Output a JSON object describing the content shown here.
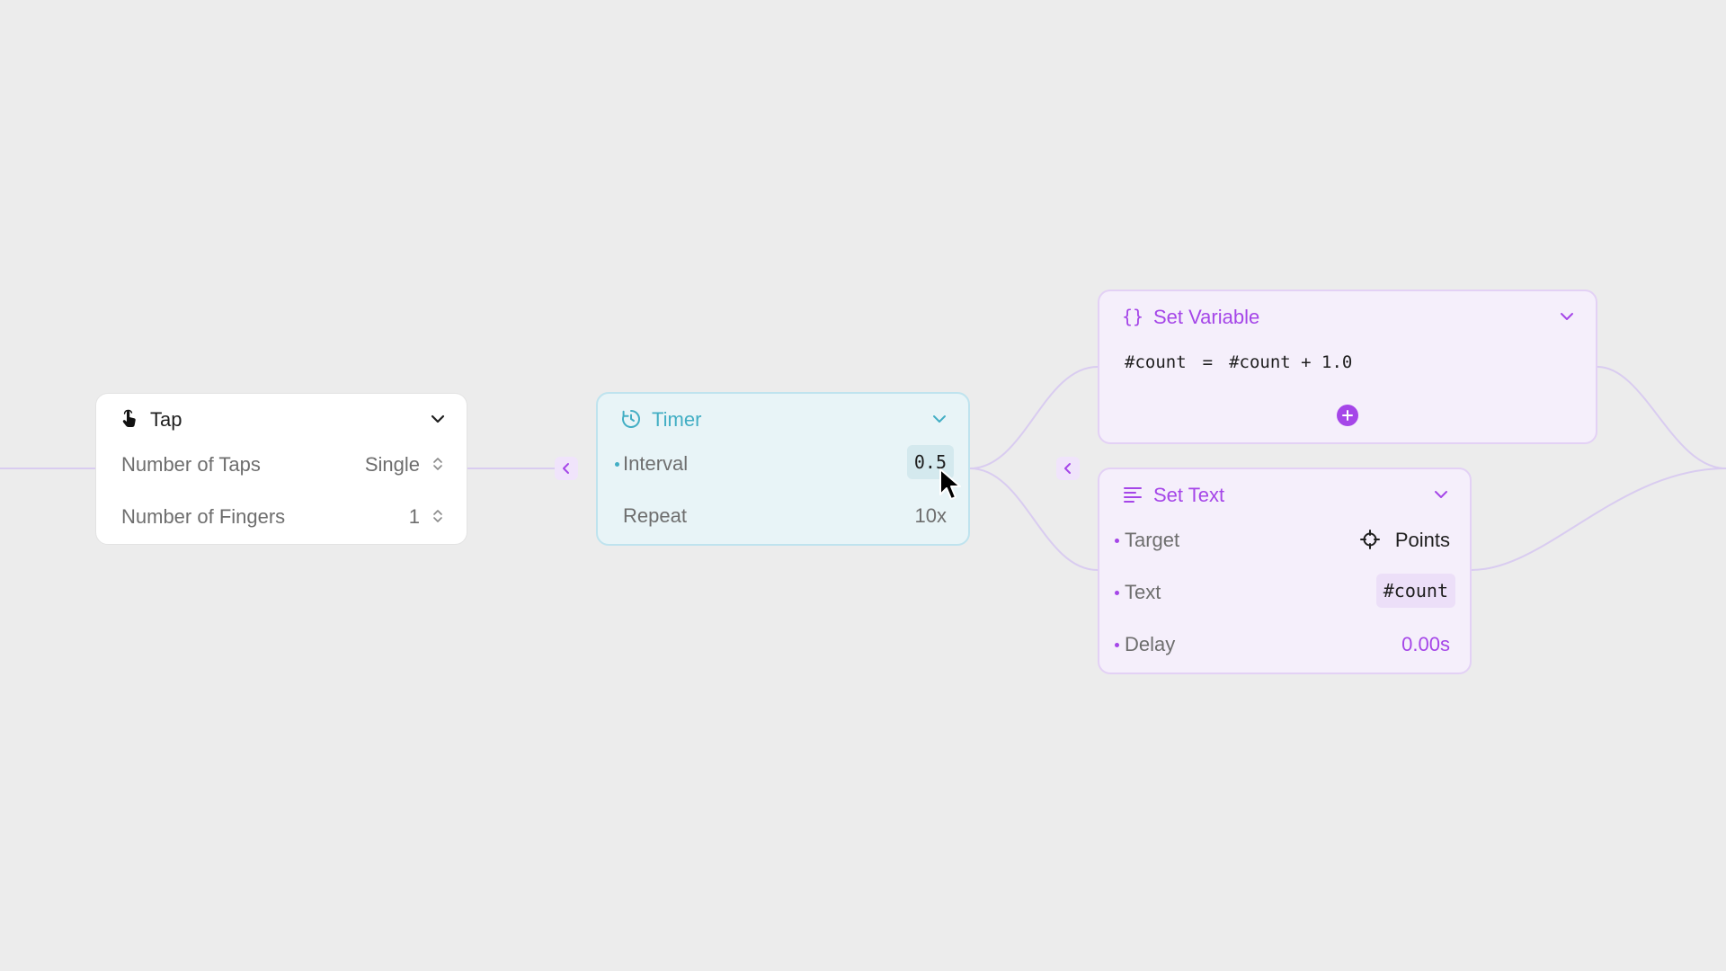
{
  "colors": {
    "canvas": "#ececec",
    "wire": "#d9ccf0",
    "purple": "#a546e8",
    "teal": "#42aec4",
    "grey_text": "#6e6e6e",
    "dark_text": "#1f1f1f"
  },
  "tap_node": {
    "title": "Tap",
    "icon": "hand-tap-icon",
    "rows": [
      {
        "label": "Number of Taps",
        "value": "Single"
      },
      {
        "label": "Number of Fingers",
        "value": "1"
      }
    ]
  },
  "timer_node": {
    "title": "Timer",
    "icon": "timer-icon",
    "rows": [
      {
        "label": "Interval",
        "value": "0.5"
      },
      {
        "label": "Repeat",
        "value": "10x"
      }
    ]
  },
  "set_variable_node": {
    "title": "Set Variable",
    "icon": "braces-icon",
    "expression": {
      "variable": "#count",
      "operator": "=",
      "value": "#count + 1.0"
    }
  },
  "set_text_node": {
    "title": "Set Text",
    "icon": "text-align-icon",
    "rows": [
      {
        "label": "Target",
        "value": "Points"
      },
      {
        "label": "Text",
        "value": "#count"
      },
      {
        "label": "Delay",
        "value": "0.00s"
      }
    ]
  }
}
